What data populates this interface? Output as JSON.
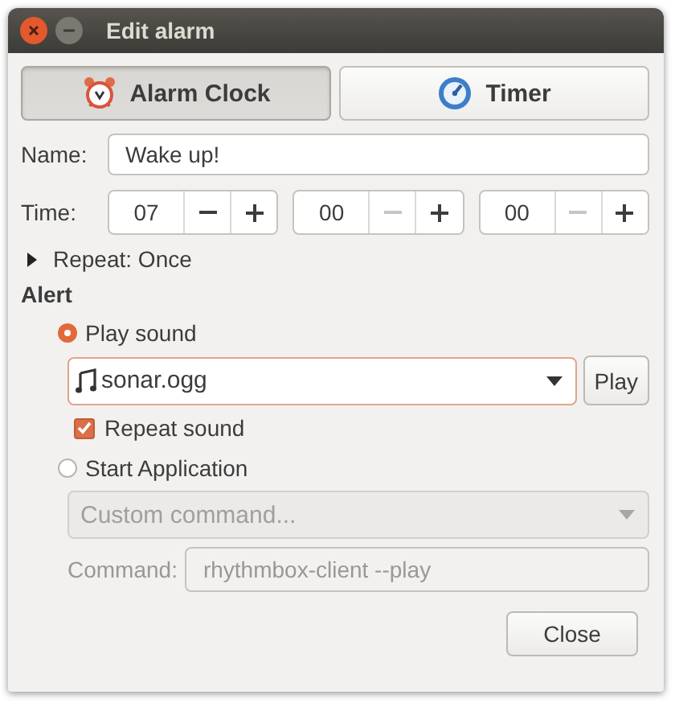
{
  "window": {
    "title": "Edit alarm"
  },
  "tabs": [
    {
      "label": "Alarm Clock",
      "kind": "alarm",
      "selected": true
    },
    {
      "label": "Timer",
      "kind": "timer",
      "selected": false
    }
  ],
  "name": {
    "label": "Name:",
    "value": "Wake up!"
  },
  "time": {
    "label": "Time:",
    "spinners": [
      {
        "value": "07",
        "minus_disabled": false
      },
      {
        "value": "00",
        "minus_disabled": true
      },
      {
        "value": "00",
        "minus_disabled": true
      }
    ]
  },
  "repeat": {
    "label": "Repeat: Once",
    "expanded": false
  },
  "alert": {
    "heading": "Alert",
    "play_sound": {
      "label": "Play sound",
      "selected": true,
      "sound": "sonar.ogg",
      "play_button": "Play",
      "repeat_label": "Repeat sound",
      "repeat_checked": true
    },
    "start_application": {
      "label": "Start Application",
      "selected": false,
      "disabled": true,
      "command_placeholder": "Custom command...",
      "command_label": "Command:",
      "command_value": "rhythmbox-client --play"
    }
  },
  "buttons": [
    "Close"
  ]
}
